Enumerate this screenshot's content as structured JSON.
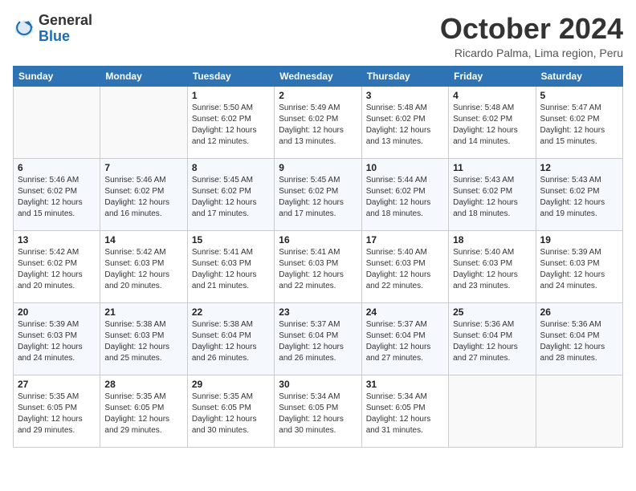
{
  "header": {
    "logo_general": "General",
    "logo_blue": "Blue",
    "month_title": "October 2024",
    "location": "Ricardo Palma, Lima region, Peru"
  },
  "days_of_week": [
    "Sunday",
    "Monday",
    "Tuesday",
    "Wednesday",
    "Thursday",
    "Friday",
    "Saturday"
  ],
  "weeks": [
    [
      {
        "day": "",
        "info": ""
      },
      {
        "day": "",
        "info": ""
      },
      {
        "day": "1",
        "info": "Sunrise: 5:50 AM\nSunset: 6:02 PM\nDaylight: 12 hours and 12 minutes."
      },
      {
        "day": "2",
        "info": "Sunrise: 5:49 AM\nSunset: 6:02 PM\nDaylight: 12 hours and 13 minutes."
      },
      {
        "day": "3",
        "info": "Sunrise: 5:48 AM\nSunset: 6:02 PM\nDaylight: 12 hours and 13 minutes."
      },
      {
        "day": "4",
        "info": "Sunrise: 5:48 AM\nSunset: 6:02 PM\nDaylight: 12 hours and 14 minutes."
      },
      {
        "day": "5",
        "info": "Sunrise: 5:47 AM\nSunset: 6:02 PM\nDaylight: 12 hours and 15 minutes."
      }
    ],
    [
      {
        "day": "6",
        "info": "Sunrise: 5:46 AM\nSunset: 6:02 PM\nDaylight: 12 hours and 15 minutes."
      },
      {
        "day": "7",
        "info": "Sunrise: 5:46 AM\nSunset: 6:02 PM\nDaylight: 12 hours and 16 minutes."
      },
      {
        "day": "8",
        "info": "Sunrise: 5:45 AM\nSunset: 6:02 PM\nDaylight: 12 hours and 17 minutes."
      },
      {
        "day": "9",
        "info": "Sunrise: 5:45 AM\nSunset: 6:02 PM\nDaylight: 12 hours and 17 minutes."
      },
      {
        "day": "10",
        "info": "Sunrise: 5:44 AM\nSunset: 6:02 PM\nDaylight: 12 hours and 18 minutes."
      },
      {
        "day": "11",
        "info": "Sunrise: 5:43 AM\nSunset: 6:02 PM\nDaylight: 12 hours and 18 minutes."
      },
      {
        "day": "12",
        "info": "Sunrise: 5:43 AM\nSunset: 6:02 PM\nDaylight: 12 hours and 19 minutes."
      }
    ],
    [
      {
        "day": "13",
        "info": "Sunrise: 5:42 AM\nSunset: 6:02 PM\nDaylight: 12 hours and 20 minutes."
      },
      {
        "day": "14",
        "info": "Sunrise: 5:42 AM\nSunset: 6:03 PM\nDaylight: 12 hours and 20 minutes."
      },
      {
        "day": "15",
        "info": "Sunrise: 5:41 AM\nSunset: 6:03 PM\nDaylight: 12 hours and 21 minutes."
      },
      {
        "day": "16",
        "info": "Sunrise: 5:41 AM\nSunset: 6:03 PM\nDaylight: 12 hours and 22 minutes."
      },
      {
        "day": "17",
        "info": "Sunrise: 5:40 AM\nSunset: 6:03 PM\nDaylight: 12 hours and 22 minutes."
      },
      {
        "day": "18",
        "info": "Sunrise: 5:40 AM\nSunset: 6:03 PM\nDaylight: 12 hours and 23 minutes."
      },
      {
        "day": "19",
        "info": "Sunrise: 5:39 AM\nSunset: 6:03 PM\nDaylight: 12 hours and 24 minutes."
      }
    ],
    [
      {
        "day": "20",
        "info": "Sunrise: 5:39 AM\nSunset: 6:03 PM\nDaylight: 12 hours and 24 minutes."
      },
      {
        "day": "21",
        "info": "Sunrise: 5:38 AM\nSunset: 6:03 PM\nDaylight: 12 hours and 25 minutes."
      },
      {
        "day": "22",
        "info": "Sunrise: 5:38 AM\nSunset: 6:04 PM\nDaylight: 12 hours and 26 minutes."
      },
      {
        "day": "23",
        "info": "Sunrise: 5:37 AM\nSunset: 6:04 PM\nDaylight: 12 hours and 26 minutes."
      },
      {
        "day": "24",
        "info": "Sunrise: 5:37 AM\nSunset: 6:04 PM\nDaylight: 12 hours and 27 minutes."
      },
      {
        "day": "25",
        "info": "Sunrise: 5:36 AM\nSunset: 6:04 PM\nDaylight: 12 hours and 27 minutes."
      },
      {
        "day": "26",
        "info": "Sunrise: 5:36 AM\nSunset: 6:04 PM\nDaylight: 12 hours and 28 minutes."
      }
    ],
    [
      {
        "day": "27",
        "info": "Sunrise: 5:35 AM\nSunset: 6:05 PM\nDaylight: 12 hours and 29 minutes."
      },
      {
        "day": "28",
        "info": "Sunrise: 5:35 AM\nSunset: 6:05 PM\nDaylight: 12 hours and 29 minutes."
      },
      {
        "day": "29",
        "info": "Sunrise: 5:35 AM\nSunset: 6:05 PM\nDaylight: 12 hours and 30 minutes."
      },
      {
        "day": "30",
        "info": "Sunrise: 5:34 AM\nSunset: 6:05 PM\nDaylight: 12 hours and 30 minutes."
      },
      {
        "day": "31",
        "info": "Sunrise: 5:34 AM\nSunset: 6:05 PM\nDaylight: 12 hours and 31 minutes."
      },
      {
        "day": "",
        "info": ""
      },
      {
        "day": "",
        "info": ""
      }
    ]
  ]
}
